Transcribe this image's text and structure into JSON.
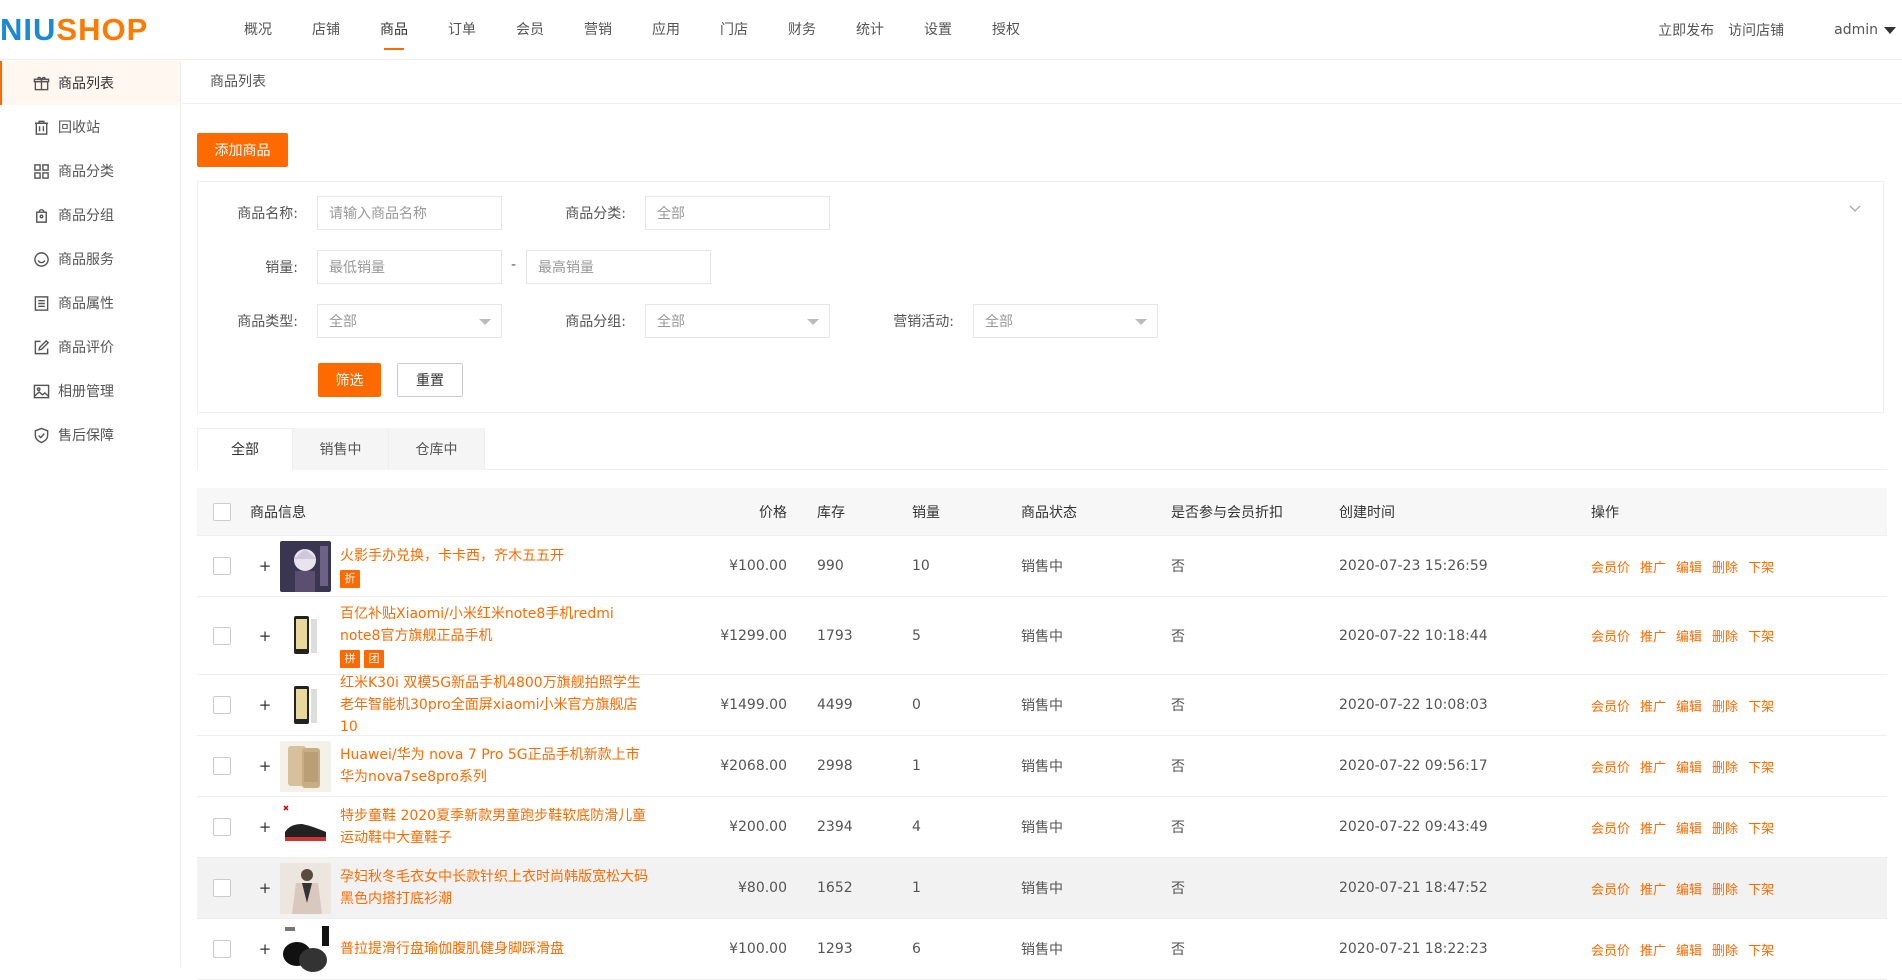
{
  "logo": {
    "part1": "NIU",
    "part2": "SHOP"
  },
  "nav": [
    {
      "label": "概况",
      "active": false
    },
    {
      "label": "店铺",
      "active": false
    },
    {
      "label": "商品",
      "active": true
    },
    {
      "label": "订单",
      "active": false
    },
    {
      "label": "会员",
      "active": false
    },
    {
      "label": "营销",
      "active": false
    },
    {
      "label": "应用",
      "active": false
    },
    {
      "label": "门店",
      "active": false
    },
    {
      "label": "财务",
      "active": false
    },
    {
      "label": "统计",
      "active": false
    },
    {
      "label": "设置",
      "active": false
    },
    {
      "label": "授权",
      "active": false
    }
  ],
  "top_actions": {
    "publish": "立即发布",
    "visit": "访问店铺",
    "user": "admin"
  },
  "sidebar": [
    {
      "label": "商品列表",
      "icon": "gift-icon",
      "active": true
    },
    {
      "label": "回收站",
      "icon": "trash-icon",
      "active": false
    },
    {
      "label": "商品分类",
      "icon": "grid-icon",
      "active": false
    },
    {
      "label": "商品分组",
      "icon": "tag-icon",
      "active": false
    },
    {
      "label": "商品服务",
      "icon": "smile-icon",
      "active": false
    },
    {
      "label": "商品属性",
      "icon": "list-icon",
      "active": false
    },
    {
      "label": "商品评价",
      "icon": "edit-icon",
      "active": false
    },
    {
      "label": "相册管理",
      "icon": "image-icon",
      "active": false
    },
    {
      "label": "售后保障",
      "icon": "shield-icon",
      "active": false
    }
  ],
  "breadcrumb": "商品列表",
  "add_button": "添加商品",
  "filter": {
    "name_label": "商品名称:",
    "name_placeholder": "请输入商品名称",
    "category_label": "商品分类:",
    "category_value": "全部",
    "sales_label": "销量:",
    "sales_min_placeholder": "最低销量",
    "sales_dash": "-",
    "sales_max_placeholder": "最高销量",
    "type_label": "商品类型:",
    "type_value": "全部",
    "group_label": "商品分组:",
    "group_value": "全部",
    "promo_label": "营销活动:",
    "promo_value": "全部",
    "filter_button": "筛选",
    "reset_button": "重置"
  },
  "tabs": [
    {
      "label": "全部",
      "active": true
    },
    {
      "label": "销售中",
      "active": false
    },
    {
      "label": "仓库中",
      "active": false
    }
  ],
  "table": {
    "headers": {
      "info": "商品信息",
      "price": "价格",
      "stock": "库存",
      "sales": "销量",
      "status": "商品状态",
      "member": "是否参与会员折扣",
      "time": "创建时间",
      "ops": "操作"
    },
    "ops": [
      "会员价",
      "推广",
      "编辑",
      "删除",
      "下架"
    ],
    "rows": [
      {
        "name": "火影手办兑换，卡卡西，齐木五五开",
        "tags": [
          "折"
        ],
        "price": "¥100.00",
        "stock": "990",
        "sales": "10",
        "status": "销售中",
        "member": "否",
        "time": "2020-07-23 15:26:59",
        "thumb": "figure"
      },
      {
        "name": "百亿补贴Xiaomi/小米红米note8手机redmi note8官方旗舰正品手机",
        "tags": [
          "拼",
          "团"
        ],
        "price": "¥1299.00",
        "stock": "1793",
        "sales": "5",
        "status": "销售中",
        "member": "否",
        "time": "2020-07-22 10:18:44",
        "thumb": "phone"
      },
      {
        "name": "红米K30i 双模5G新品手机4800万旗舰拍照学生老年智能机30pro全面屏xiaomi小米官方旗舰店10",
        "tags": [],
        "price": "¥1499.00",
        "stock": "4499",
        "sales": "0",
        "status": "销售中",
        "member": "否",
        "time": "2020-07-22 10:08:03",
        "thumb": "phone"
      },
      {
        "name": "Huawei/华为 nova 7 Pro 5G正品手机新款上市华为nova7se8pro系列",
        "tags": [],
        "price": "¥2068.00",
        "stock": "2998",
        "sales": "1",
        "status": "销售中",
        "member": "否",
        "time": "2020-07-22 09:56:17",
        "thumb": "goldphone"
      },
      {
        "name": "特步童鞋 2020夏季新款男童跑步鞋软底防滑儿童运动鞋中大童鞋子",
        "tags": [],
        "price": "¥200.00",
        "stock": "2394",
        "sales": "4",
        "status": "销售中",
        "member": "否",
        "time": "2020-07-22 09:43:49",
        "thumb": "shoe"
      },
      {
        "name": "孕妇秋冬毛衣女中长款针织上衣时尚韩版宽松大码黑色内搭打底衫潮",
        "tags": [],
        "price": "¥80.00",
        "stock": "1652",
        "sales": "1",
        "status": "销售中",
        "member": "否",
        "time": "2020-07-21 18:47:52",
        "thumb": "coat",
        "hover": true
      },
      {
        "name": "普拉提滑行盘瑜伽腹肌健身脚踩滑盘",
        "tags": [],
        "price": "¥100.00",
        "stock": "1293",
        "sales": "6",
        "status": "销售中",
        "member": "否",
        "time": "2020-07-21 18:22:23",
        "thumb": "disc"
      }
    ]
  },
  "colors": {
    "accent": "#ff6a00",
    "logo_blue": "#1a8ad3",
    "logo_orange": "#ff7a00"
  }
}
